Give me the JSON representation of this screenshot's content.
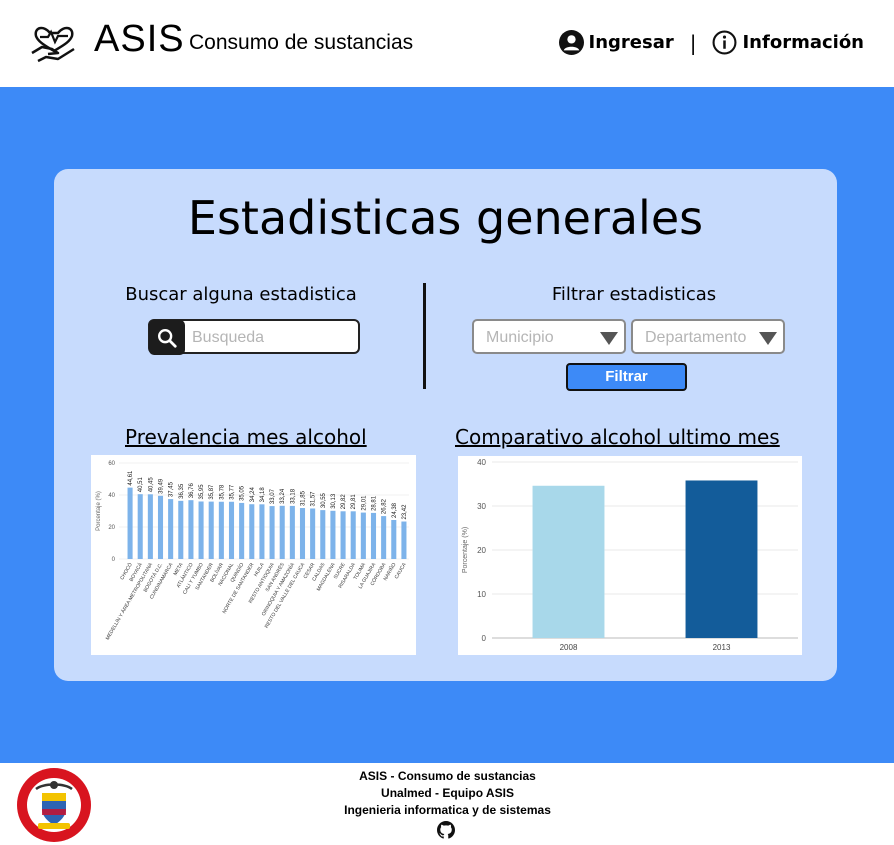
{
  "header": {
    "brand": "ASIS",
    "subtitle": "Consumo de sustancias",
    "login_label": "Ingresar",
    "separator": "|",
    "info_label": "Información"
  },
  "main": {
    "title": "Estadisticas generales",
    "search": {
      "label": "Buscar alguna estadistica",
      "placeholder": "Busqueda",
      "value": ""
    },
    "filter": {
      "label": "Filtrar estadisticas",
      "municipio": "Municipio",
      "departamento": "Departamento",
      "button": "Filtrar"
    }
  },
  "charts": {
    "left_title": "Prevalencia mes alcohol",
    "right_title": "Comparativo alcohol ultimo mes"
  },
  "chart_data": [
    {
      "type": "bar",
      "ylabel": "Porcentaje (%)",
      "ylim": [
        0,
        60
      ],
      "yticks": [
        "0",
        "20",
        "40",
        "60"
      ],
      "categories": [
        "CHOCÓ",
        "BOYACÁ",
        "MEDELLÍN Y ÁREA METROPOLITANA",
        "BOGOTÁ D.C.",
        "CUNDINAMARCA",
        "META",
        "ATLÁNTICO",
        "CALI Y YUMBO",
        "SANTANDER",
        "BOLÍVAR",
        "NACIONAL",
        "QUINDÍO",
        "NORTE DE SANTANDER",
        "HUILA",
        "RESTO ANTIOQUIA",
        "SAN ANDRÉS",
        "ORINOQUIA Y AMAZONÍA",
        "RESTO DEL VALLE DEL CAUCA",
        "CESAR",
        "CALDAS",
        "MAGDALENA",
        "SUCRE",
        "RISARALDA",
        "TOLIMA",
        "LA GUAJIRA",
        "CÓRDOBA",
        "NARIÑO",
        "CAUCA"
      ],
      "values": [
        44.61,
        40.51,
        40.45,
        39.49,
        37.45,
        36.35,
        36.76,
        35.95,
        35.87,
        35.78,
        35.77,
        35.05,
        34.24,
        34.18,
        33.07,
        33.24,
        33.18,
        31.85,
        31.57,
        30.55,
        30.13,
        29.82,
        29.81,
        29.01,
        28.81,
        26.82,
        24.38,
        23.42
      ],
      "color": "#7db3ea"
    },
    {
      "type": "bar",
      "ylabel": "Porcentaje (%)",
      "ylim": [
        0,
        40
      ],
      "yticks": [
        "0",
        "10",
        "20",
        "30",
        "40"
      ],
      "categories": [
        "2008",
        "2013"
      ],
      "values": [
        34.6,
        35.8
      ],
      "colors": [
        "#a8d8ea",
        "#135c9a"
      ]
    }
  ],
  "footer": {
    "line1": "ASIS - Consumo de sustancias",
    "line2": "Unalmed - Equipo ASIS",
    "line3": "Ingenieria informatica y de sistemas",
    "seal_text": "REPÚBLICA DE COLOMBIA · LIBERTAD Y ORDEN"
  },
  "colors": {
    "primary": "#3d8af7",
    "card": "#c7dbfd",
    "dark": "#1c1c1c"
  }
}
